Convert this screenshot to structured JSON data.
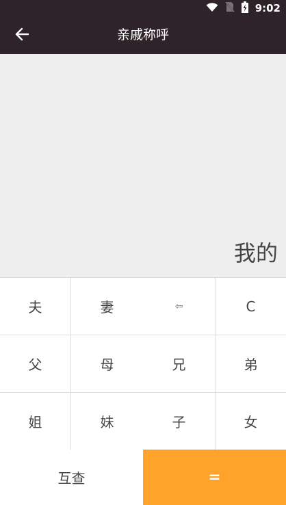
{
  "status_bar": {
    "time": "9:02",
    "icons": [
      "wifi-icon",
      "no-sim-icon",
      "battery-charging-icon"
    ]
  },
  "app_bar": {
    "title": "亲戚称呼",
    "back_icon": "arrow-left-icon"
  },
  "display": {
    "text": "我的"
  },
  "keypad": {
    "row1": {
      "husband": "夫",
      "wife": "妻",
      "backspace": "⇦",
      "clear": "C"
    },
    "row2": {
      "father": "父",
      "mother": "母",
      "elder_brother": "兄",
      "younger_brother": "弟"
    },
    "row3": {
      "elder_sister": "姐",
      "younger_sister": "妹",
      "son": "子",
      "daughter": "女"
    }
  },
  "bottom": {
    "swap_label": "互查",
    "equals_label": "="
  },
  "colors": {
    "app_bar": "#2e2328",
    "display_bg": "#eeeeee",
    "accent": "#ffa32a",
    "key_text": "#444444",
    "divider": "#dddddd"
  }
}
